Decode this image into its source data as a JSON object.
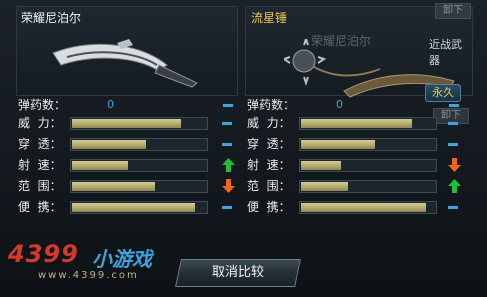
{
  "left_weapon": {
    "name": "荣耀尼泊尔",
    "ammo_label": "弹药数：",
    "ammo_value": "0",
    "stats": [
      {
        "label": "威  力：",
        "level": 0.81
      },
      {
        "label": "穿  透：",
        "level": 0.55
      },
      {
        "label": "射  速：",
        "level": 0.42
      },
      {
        "label": "范  围：",
        "level": 0.62
      },
      {
        "label": "便  携：",
        "level": 0.92
      }
    ]
  },
  "right_weapon": {
    "name": "流星锤",
    "ammo_label": "弹药数：",
    "ammo_value": "0",
    "stats": [
      {
        "label": "威  力：",
        "level": 0.83
      },
      {
        "label": "穿  透：",
        "level": 0.55
      },
      {
        "label": "射  速：",
        "level": 0.3
      },
      {
        "label": "范  围：",
        "level": 0.35
      },
      {
        "label": "便  携：",
        "level": 0.93
      }
    ]
  },
  "comparison_icons": [
    {
      "name": "power",
      "left": "dash",
      "right": "dash"
    },
    {
      "name": "penetration",
      "left": "dash",
      "right": "dash"
    },
    {
      "name": "fire_rate",
      "left": "arrow-up",
      "right": "arrow-down"
    },
    {
      "name": "range",
      "left": "arrow-down",
      "right": "arrow-up"
    },
    {
      "name": "portability",
      "left": "dash",
      "right": "dash"
    }
  ],
  "background": {
    "ghost_name": "荣耀尼泊尔",
    "melee_tag": "近战武器",
    "forever_badge": "永久",
    "unload_label": "卸下",
    "unload_label_2": "卸下"
  },
  "cancel_button": "取消比较",
  "logo": {
    "brand": "4399",
    "brand2": "小游戏",
    "url": "www.4399.com"
  },
  "colors": {
    "bar_fill": "#c6bf86",
    "accent_blue": "#37a8e0",
    "up_green": "#1fbf3a",
    "down_orange": "#f2641c",
    "title_gold": "#f2c34a"
  }
}
